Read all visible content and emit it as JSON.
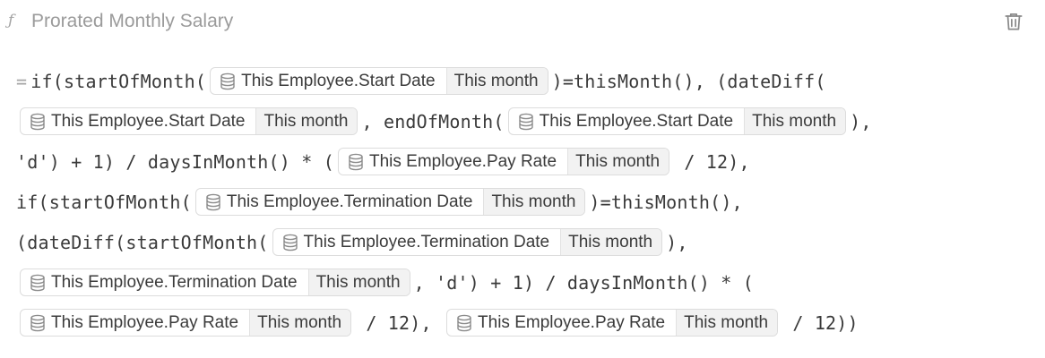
{
  "header": {
    "icon": "function-icon",
    "title": "Prorated Monthly Salary",
    "delete_icon": "trash-icon"
  },
  "formula": {
    "chip_icon": "database-icon",
    "lines": [
      [
        {
          "type": "text",
          "value": "=",
          "muted": true
        },
        {
          "type": "text",
          "value": "if(startOfMonth("
        },
        {
          "type": "chip",
          "field": "This Employee.Start Date",
          "period": "This month"
        },
        {
          "type": "text",
          "value": ")=thisMonth(), (dateDiff("
        }
      ],
      [
        {
          "type": "chip",
          "field": "This Employee.Start Date",
          "period": "This month"
        },
        {
          "type": "text",
          "value": ", endOfMonth("
        },
        {
          "type": "chip",
          "field": "This Employee.Start Date",
          "period": "This month"
        },
        {
          "type": "text",
          "value": "),"
        }
      ],
      [
        {
          "type": "text",
          "value": "'d') + 1) / daysInMonth() * ("
        },
        {
          "type": "chip",
          "field": "This Employee.Pay Rate",
          "period": "This month"
        },
        {
          "type": "text",
          "value": " / 12),"
        }
      ],
      [
        {
          "type": "text",
          "value": "if(startOfMonth("
        },
        {
          "type": "chip",
          "field": "This Employee.Termination Date",
          "period": "This month"
        },
        {
          "type": "text",
          "value": ")=thisMonth(),"
        }
      ],
      [
        {
          "type": "text",
          "value": "(dateDiff(startOfMonth("
        },
        {
          "type": "chip",
          "field": "This Employee.Termination Date",
          "period": "This month"
        },
        {
          "type": "text",
          "value": "),"
        }
      ],
      [
        {
          "type": "chip",
          "field": "This Employee.Termination Date",
          "period": "This month"
        },
        {
          "type": "text",
          "value": ", 'd') + 1) / daysInMonth() * ("
        }
      ],
      [
        {
          "type": "chip",
          "field": "This Employee.Pay Rate",
          "period": "This month"
        },
        {
          "type": "text",
          "value": " / 12), "
        },
        {
          "type": "chip",
          "field": "This Employee.Pay Rate",
          "period": "This month"
        },
        {
          "type": "text",
          "value": " / 12))"
        }
      ]
    ]
  },
  "colors": {
    "title": "#9b9b9b",
    "code": "#3a3a3a",
    "chip_border": "#dcdcdc",
    "chip_period_bg": "#f2f2f2"
  }
}
